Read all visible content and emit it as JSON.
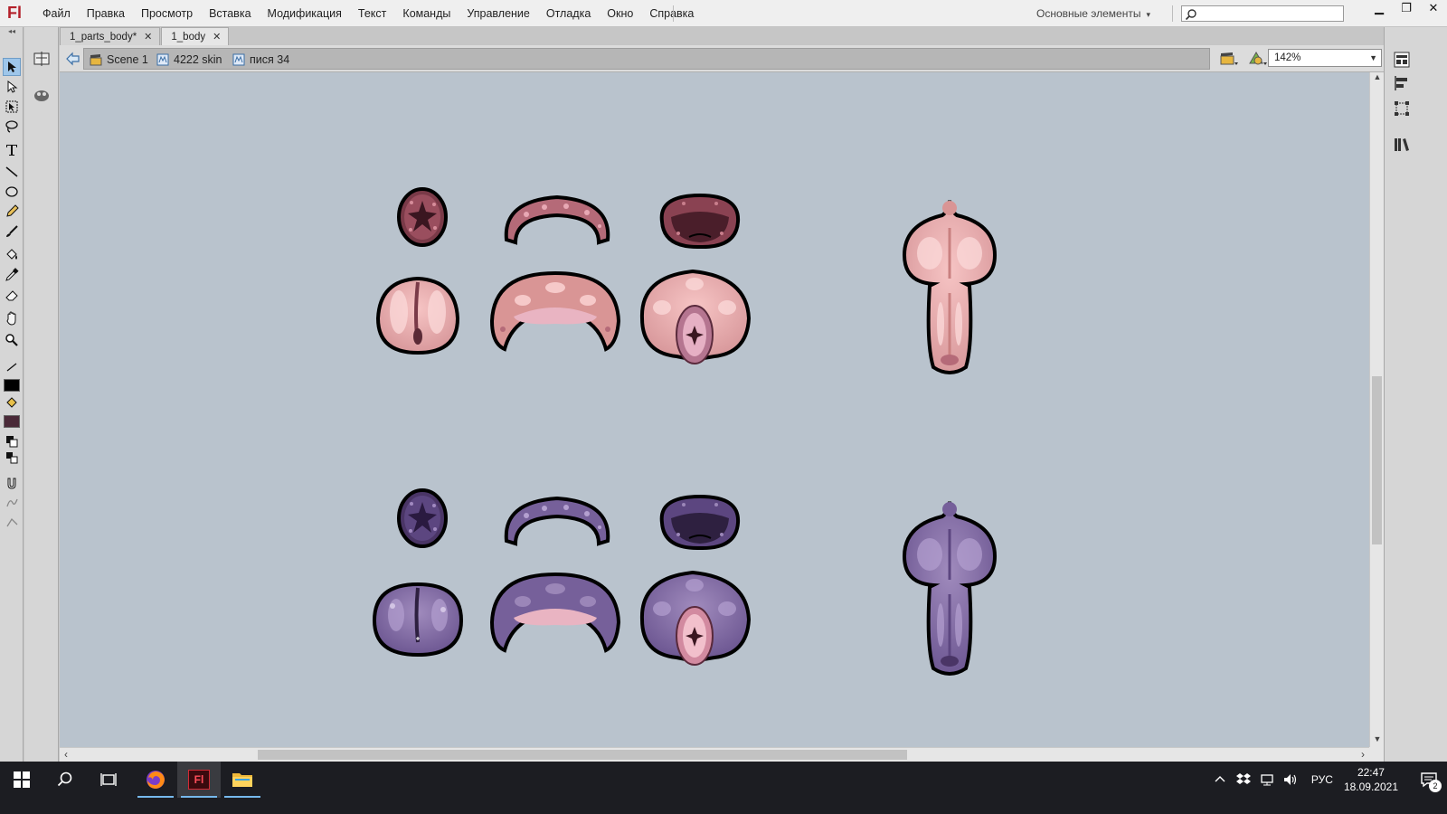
{
  "app": {
    "logo": "Fl",
    "menu": [
      "Файл",
      "Правка",
      "Просмотр",
      "Вставка",
      "Модификация",
      "Текст",
      "Команды",
      "Управление",
      "Отладка",
      "Окно",
      "Справка"
    ],
    "workspace": "Основные элементы",
    "window_controls": [
      "minimize-icon",
      "restore-icon",
      "close-icon"
    ]
  },
  "tabs": [
    {
      "label": "1_parts_body*",
      "active": false
    },
    {
      "label": "1_body",
      "active": true
    }
  ],
  "breadcrumb": [
    "Scene 1",
    "4222 skin",
    "пися 34"
  ],
  "zoom": "142%",
  "tools": [
    "selection-tool",
    "subselection-tool",
    "free-transform-tool",
    "lasso-tool",
    "text-tool",
    "line-tool",
    "oval-tool",
    "pencil-tool",
    "brush-tool",
    "paint-bucket-tool",
    "eyedropper-tool",
    "eraser-tool",
    "hand-tool",
    "zoom-tool",
    "stroke-color",
    "fill-color",
    "snap-to-objects",
    "smooth",
    "straighten"
  ],
  "colors": {
    "stage_bg": "#b9c3cd",
    "stroke_swatch": "#000000",
    "fill_swatch": "#4a2a38",
    "pink_light": "#f2b8b8",
    "pink_mid": "#c9878a",
    "pink_dark": "#7a3a48",
    "purple_light": "#9b86b8",
    "purple_mid": "#76609a",
    "purple_dark": "#4a3566"
  },
  "taskbar": {
    "apps": [
      "windows-start",
      "search",
      "task-view",
      "firefox",
      "animate",
      "file-explorer"
    ],
    "language": "РУС",
    "time": "22:47",
    "date": "18.09.2021",
    "notifications": "2"
  }
}
